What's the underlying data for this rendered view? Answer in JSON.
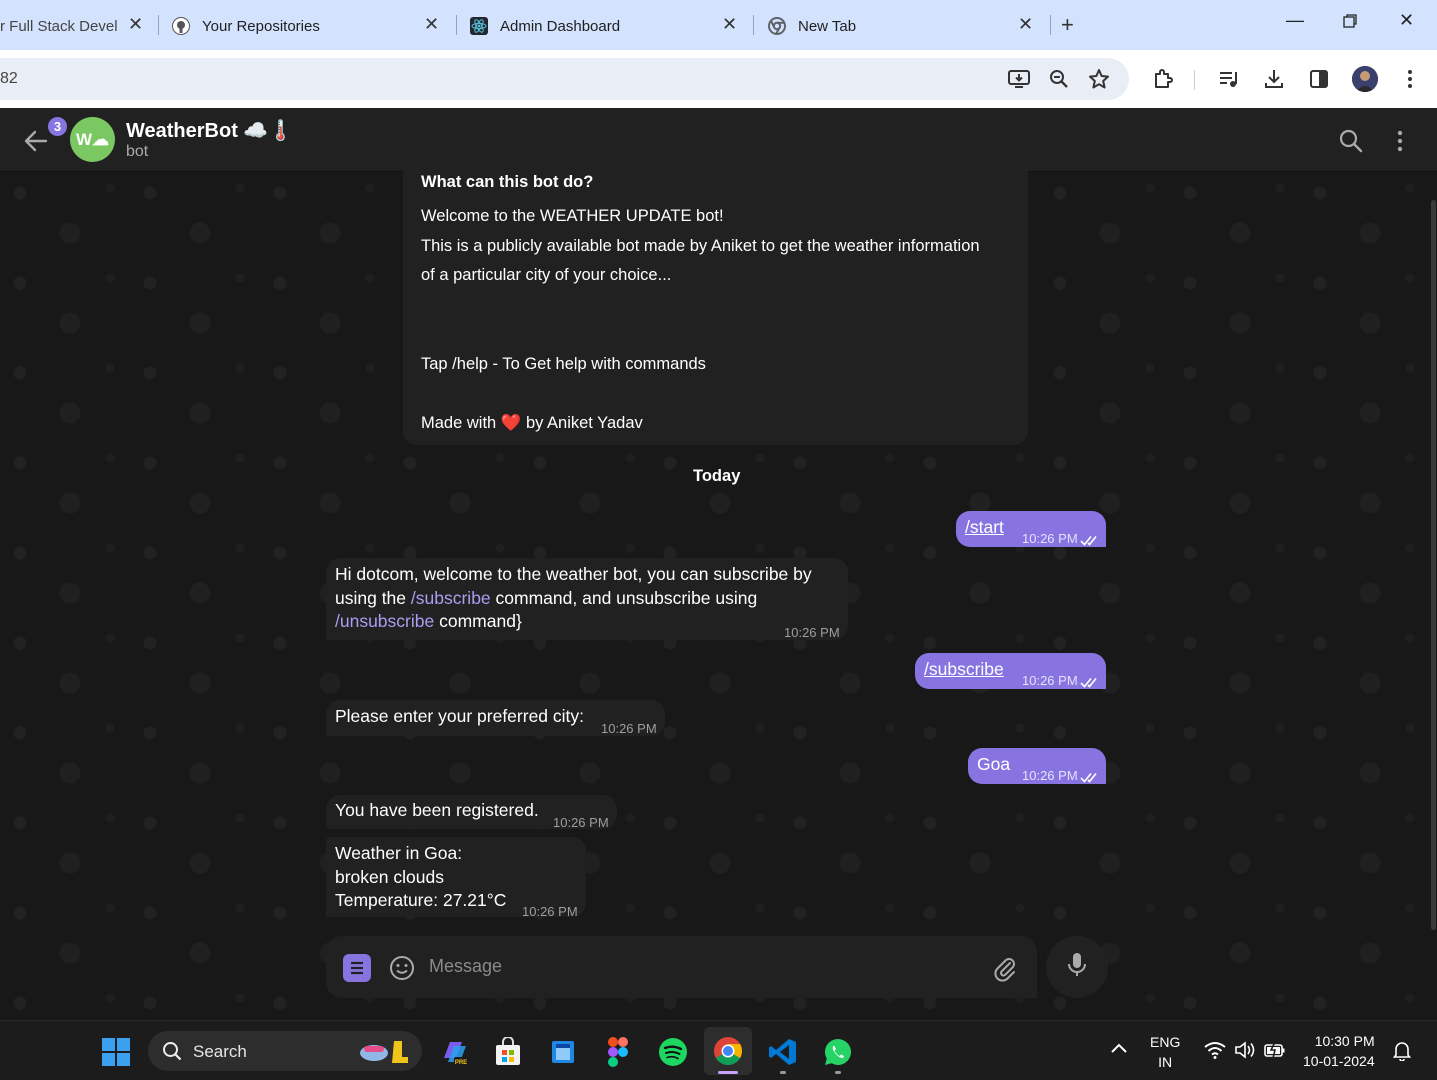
{
  "browser": {
    "tabs": [
      {
        "title": "r Full Stack Devel",
        "icon": "page-icon"
      },
      {
        "title": "Your Repositories",
        "icon": "github-icon"
      },
      {
        "title": "Admin Dashboard",
        "icon": "react-icon"
      },
      {
        "title": "New Tab",
        "icon": "chrome-icon"
      }
    ],
    "url_fragment": "82"
  },
  "chat": {
    "title": "WeatherBot ☁️🌡️",
    "subtitle": "bot",
    "unread_count": "3",
    "avatar_letters": "W☁",
    "intro": {
      "heading": "What can this bot do?",
      "line1": "Welcome to the WEATHER UPDATE bot!",
      "line2": "This is a publicly available bot made by Aniket to get the weather information",
      "line3": "of a particular city of your choice...",
      "line4": "Tap /help - To Get help with commands",
      "line5_pre": "Made with",
      "line5_emoji": "❤️",
      "line5_post": "by Aniket Yadav"
    },
    "date_separator": "Today",
    "messages": [
      {
        "dir": "out",
        "text": "/start",
        "time": "10:26 PM"
      },
      {
        "dir": "in",
        "line1": "Hi dotcom, welcome to the weather bot, you can subscribe by",
        "line2_pre": "using the",
        "line2_link": "/subscribe",
        "line2_post": "command, and unsubscribe using",
        "line3_link": "/unsubscribe",
        "line3_post": "command}",
        "time": "10:26 PM"
      },
      {
        "dir": "out",
        "text": "/subscribe",
        "time": "10:26 PM"
      },
      {
        "dir": "in",
        "text": "Please enter your preferred city:",
        "time": "10:26 PM"
      },
      {
        "dir": "out",
        "text": "Goa",
        "time": "10:26 PM"
      },
      {
        "dir": "in",
        "text": "You have been registered.",
        "time": "10:26 PM"
      },
      {
        "dir": "in",
        "line1": "Weather in Goa:",
        "line2": "broken clouds",
        "line3": "Temperature: 27.21°C",
        "time": "10:26 PM"
      }
    ],
    "composer_placeholder": "Message"
  },
  "taskbar": {
    "search_label": "Search",
    "lang": "ENG",
    "region": "IN",
    "time": "10:30 PM",
    "date": "10-01-2024"
  },
  "colors": {
    "accent": "#8774e1",
    "bubble_in": "#212121",
    "chat_bg": "#181818",
    "tab_strip": "#d3e3fd"
  }
}
